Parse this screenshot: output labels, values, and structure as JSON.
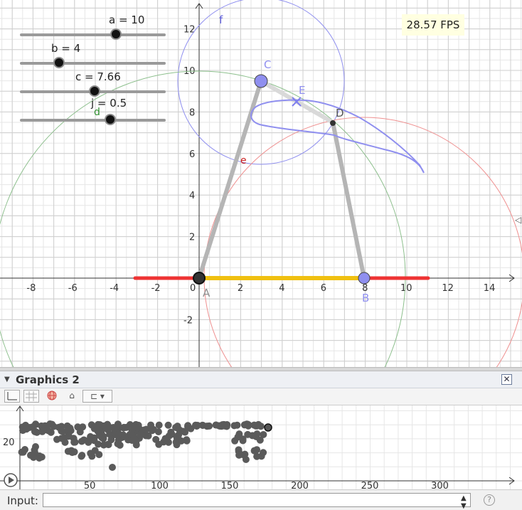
{
  "graphics1": {
    "fps": "28.57 FPS",
    "sliders": [
      {
        "label": "a = 10",
        "fraction": 0.66
      },
      {
        "label": "b = 4",
        "fraction": 0.27
      },
      {
        "label": "c = 7.66",
        "fraction": 0.51
      },
      {
        "label": "j = 0.5",
        "fraction": 0.62
      }
    ],
    "x_ticks": [
      "-8",
      "-6",
      "-4",
      "-2",
      "0",
      "2",
      "4",
      "6",
      "8",
      "10",
      "12",
      "14"
    ],
    "y_ticks": [
      "12",
      "10",
      "8",
      "6",
      "4",
      "2",
      "-2"
    ],
    "points": {
      "A": "A",
      "B": "B",
      "C": "C",
      "D": "D",
      "E": "E"
    },
    "object_labels": {
      "f": "f",
      "d": "d",
      "e": "e"
    },
    "colors": {
      "circle_f": "#8f8fef",
      "circle_d": "#8cbf8c",
      "circle_red": "#ef9090",
      "x_segment": "#ee3333",
      "base": "#f0c010",
      "rod": "#b5b5b5",
      "curve": "#8f8fef"
    }
  },
  "graphics2": {
    "title": "Graphics 2",
    "close": "✕",
    "toolbar_icons": [
      "axes-icon",
      "grid-icon",
      "globe-icon",
      "home-icon",
      "style-dropdown-icon"
    ],
    "x_ticks": [
      "50",
      "100",
      "150",
      "200",
      "250",
      "300"
    ],
    "y_ticks": [
      "20"
    ]
  },
  "input_bar": {
    "label": "Input:",
    "value": "",
    "help": "?"
  }
}
